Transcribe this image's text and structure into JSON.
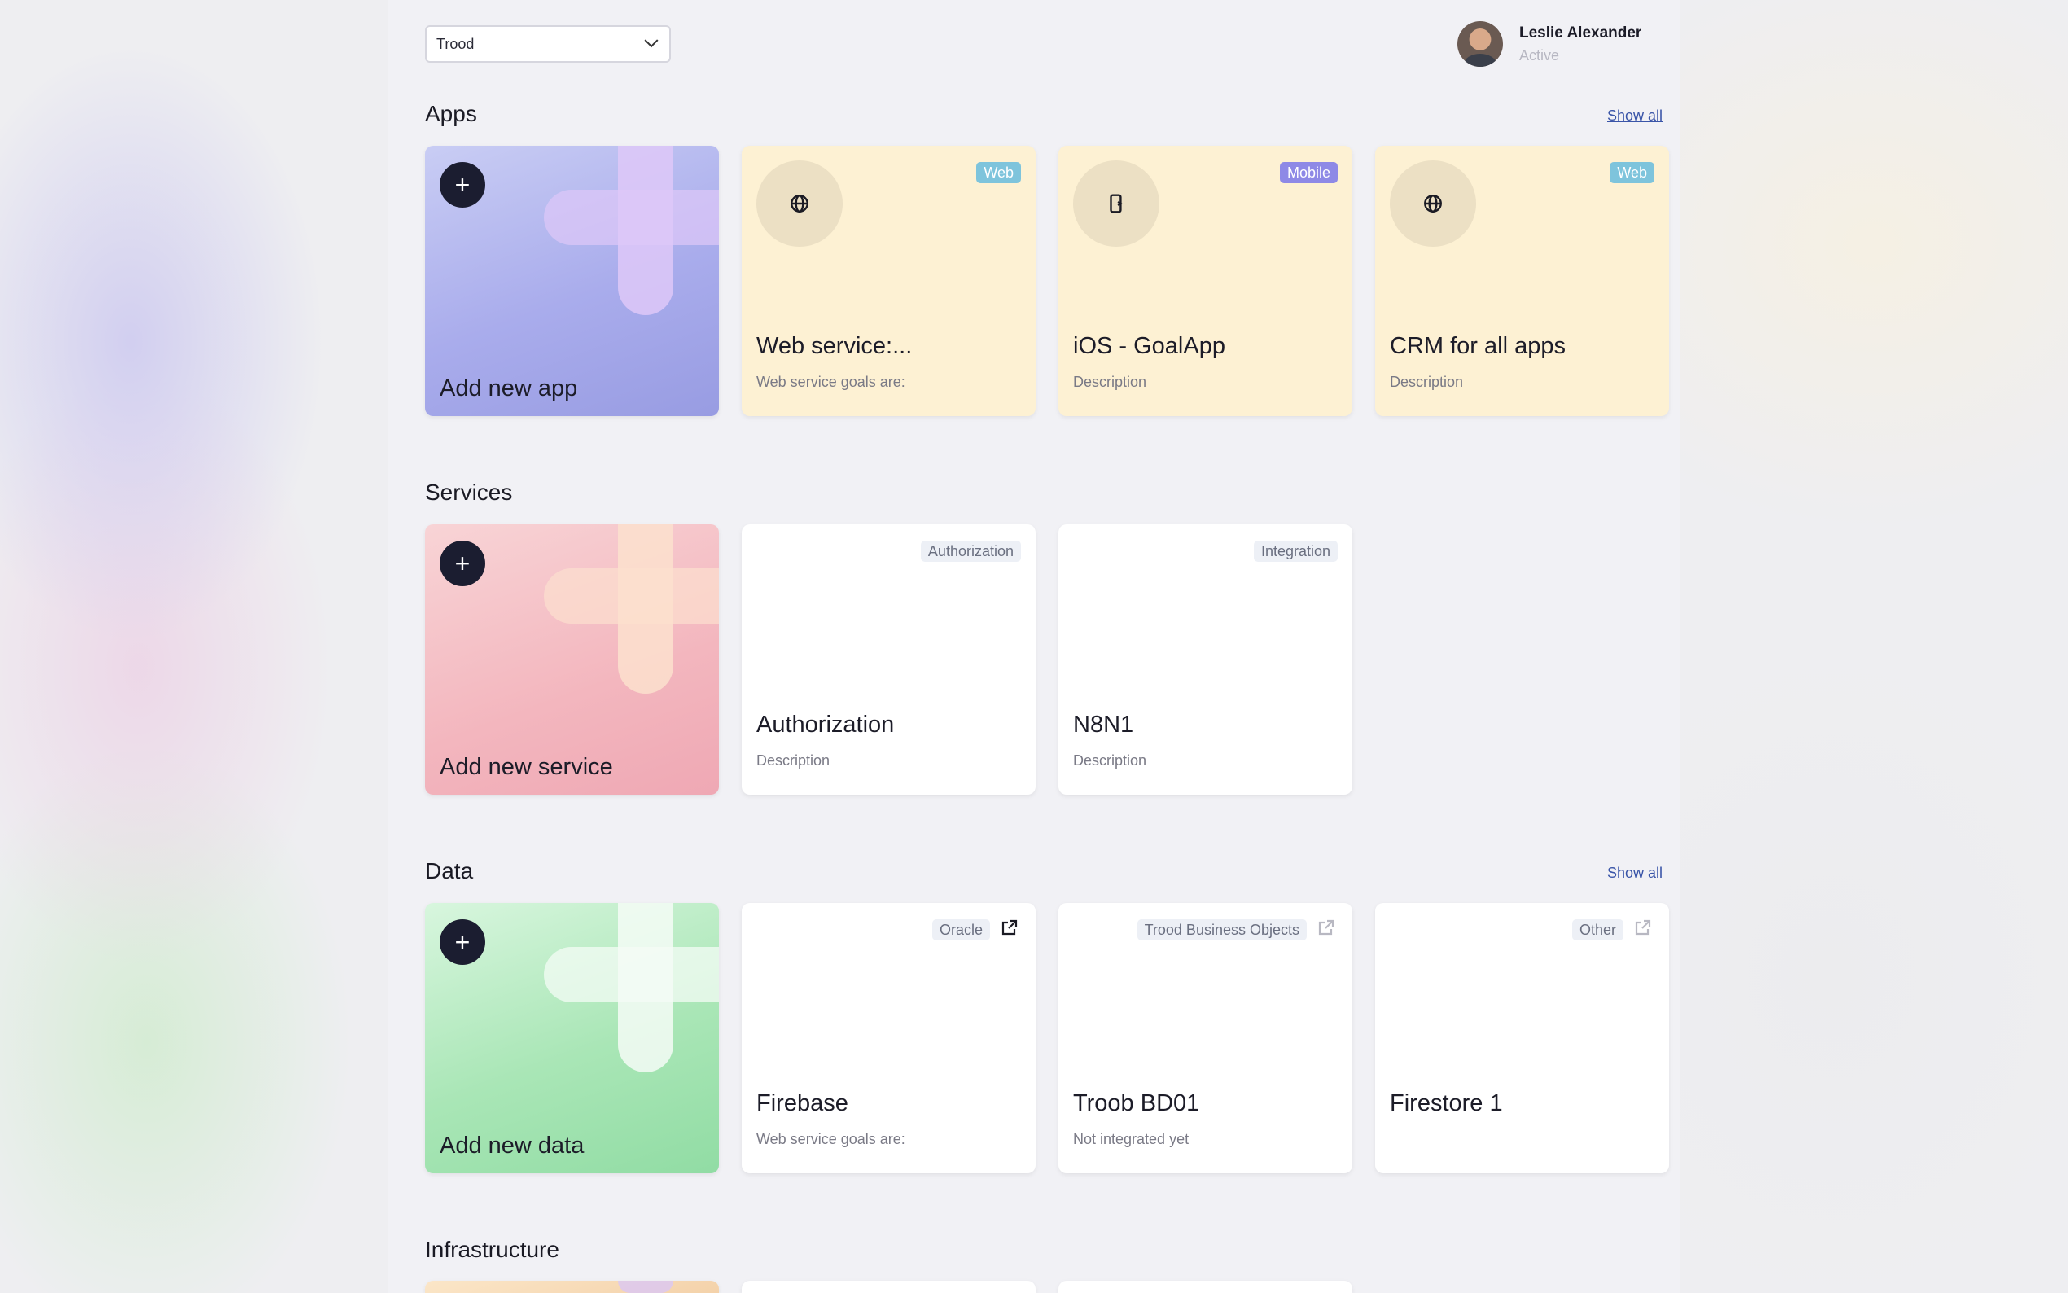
{
  "workspace_select": {
    "value": "Trood"
  },
  "user": {
    "name": "Leslie Alexander",
    "status": "Active"
  },
  "sections": {
    "apps": {
      "title": "Apps",
      "show_all": "Show all",
      "add_label": "Add new app",
      "cards": [
        {
          "title": "Web service:...",
          "description": "Web service goals are:",
          "badge": "Web",
          "icon": "globe-icon"
        },
        {
          "title": "iOS - GoalApp",
          "description": "Description",
          "badge": "Mobile",
          "icon": "mobile-app-icon"
        },
        {
          "title": "CRM for all apps",
          "description": "Description",
          "badge": "Web",
          "icon": "globe-icon"
        }
      ]
    },
    "services": {
      "title": "Services",
      "add_label": "Add new service",
      "cards": [
        {
          "title": "Authorization",
          "description": "Description",
          "badge": "Authorization"
        },
        {
          "title": "N8N1",
          "description": "Description",
          "badge": "Integration"
        }
      ]
    },
    "data": {
      "title": "Data",
      "show_all": "Show all",
      "add_label": "Add new data",
      "cards": [
        {
          "title": "Firebase",
          "description": "Web service goals are:",
          "badge": "Oracle",
          "icon": "external-link-icon"
        },
        {
          "title": "Troob BD01",
          "description": "Not integrated yet",
          "badge": "Trood Business Objects",
          "icon": "external-link-icon"
        },
        {
          "title": "Firestore 1",
          "description": "",
          "badge": "Other",
          "icon": "external-link-icon"
        }
      ]
    },
    "infrastructure": {
      "title": "Infrastructure"
    }
  },
  "colors": {
    "accent_dark": "#1b1d30",
    "web_badge": "#7ec4dc",
    "mobile_badge": "#8e89e6",
    "app_card_bg": "#fdf1d3",
    "link": "#3a55a8"
  }
}
